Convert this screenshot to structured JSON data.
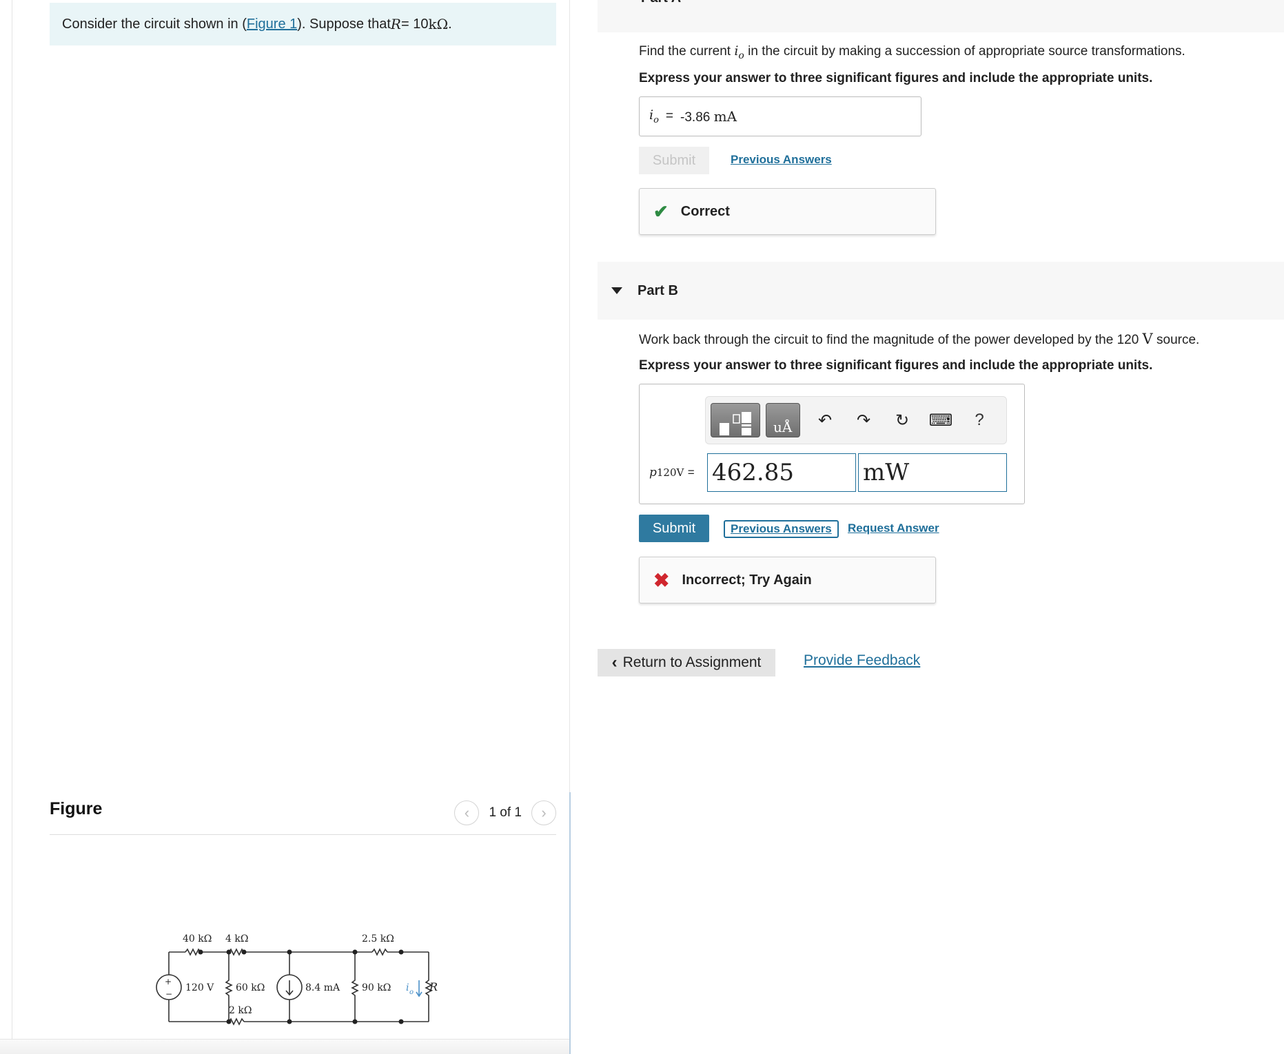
{
  "intro": {
    "prefix": "Consider the circuit shown in (",
    "figure_link": "Figure 1",
    "middle": "). Suppose that ",
    "var": "R",
    "equals": " = 10 ",
    "unit": "kΩ",
    "suffix": "."
  },
  "figure": {
    "title": "Figure",
    "pager": "1 of 1",
    "labels": {
      "r40": "40 kΩ",
      "r4": "4 kΩ",
      "r25": "2.5 kΩ",
      "v120": "120 V",
      "r60": "60 kΩ",
      "i84": "8.4 mA",
      "r90": "90 kΩ",
      "r2": "2 kΩ",
      "io": "i",
      "io_sub": "o",
      "R": "R",
      "plus": "+",
      "minus": "−"
    }
  },
  "partA": {
    "cut_title": "Part A",
    "q_pre": "Find the current ",
    "q_var": "i",
    "q_sub": "o",
    "q_post": " in the circuit by making a succession of appropriate source transformations.",
    "instruction": "Express your answer to three significant figures and include the appropriate units.",
    "answer_var": "i",
    "answer_sub": "o",
    "answer_eq": "=",
    "answer_value": "-3.86",
    "answer_unit": "mA",
    "submit": "Submit",
    "previous_answers": "Previous Answers",
    "feedback": "Correct"
  },
  "partB": {
    "title": "Part B",
    "q_pre": "Work back through the circuit to find the magnitude of the power developed by the 120 ",
    "q_unit": "V",
    "q_post": " source.",
    "instruction": "Express your answer to three significant figures and include the appropriate units.",
    "label_var": "p",
    "label_sub": "120V",
    "label_eq": "=",
    "value": "462.85",
    "unit": "mW",
    "submit": "Submit",
    "previous_answers": "Previous Answers",
    "request_answer": "Request Answer",
    "feedback": "Incorrect; Try Again",
    "toolbar": {
      "templates_icon": "templates-icon",
      "units_label": "uÅ",
      "undo": "↶",
      "redo": "↷",
      "reset": "↻",
      "keyboard": "⌨",
      "help": "?"
    }
  },
  "footer": {
    "return": "Return to Assignment",
    "feedback": "Provide Feedback"
  }
}
